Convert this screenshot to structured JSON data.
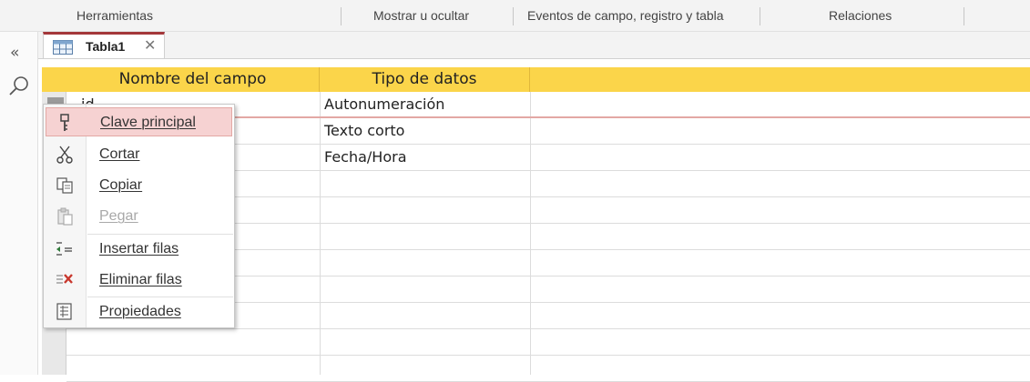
{
  "ribbon": {
    "groups": [
      "Herramientas",
      "Mostrar u ocultar",
      "Eventos de campo, registro y tabla",
      "Relaciones"
    ],
    "collapse_glyph": "«"
  },
  "document": {
    "tab_label": "Tabla1",
    "close_glyph": "✕"
  },
  "grid": {
    "headers": {
      "field_name": "Nombre del campo",
      "data_type": "Tipo de datos"
    },
    "rows": [
      {
        "field_name": "id",
        "data_type": "Autonumeración"
      },
      {
        "field_name": "",
        "data_type": "Texto corto"
      },
      {
        "field_name": "",
        "data_type": "Fecha/Hora"
      }
    ]
  },
  "context_menu": {
    "items": [
      {
        "label": "Clave principal",
        "icon": "key-icon",
        "highlighted": true,
        "disabled": false
      },
      {
        "label": "Cortar",
        "icon": "scissors-icon",
        "highlighted": false,
        "disabled": false
      },
      {
        "label": "Copiar",
        "icon": "copy-icon",
        "highlighted": false,
        "disabled": false
      },
      {
        "label": "Pegar",
        "icon": "paste-icon",
        "highlighted": false,
        "disabled": true
      },
      {
        "label": "Insertar filas",
        "icon": "insert-rows-icon",
        "highlighted": false,
        "disabled": false
      },
      {
        "label": "Eliminar filas",
        "icon": "delete-rows-icon",
        "highlighted": false,
        "disabled": false
      },
      {
        "label": "Propiedades",
        "icon": "properties-icon",
        "highlighted": false,
        "disabled": false
      }
    ]
  },
  "colors": {
    "header_yellow": "#fbd54a",
    "tab_accent": "#a4373a",
    "highlight": "#f6d2d2",
    "delete_red": "#c8372d"
  }
}
